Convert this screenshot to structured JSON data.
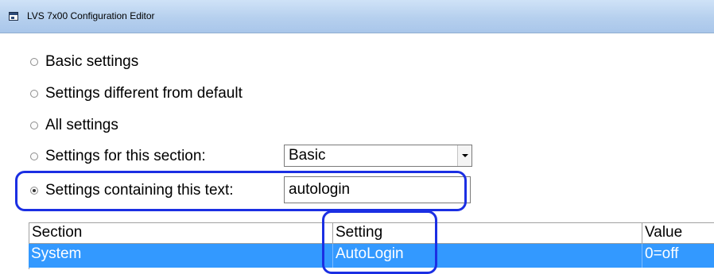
{
  "window": {
    "title": "LVS 7x00 Configuration Editor"
  },
  "options": [
    {
      "label": "Basic settings",
      "checked": false
    },
    {
      "label": "Settings different from default",
      "checked": false
    },
    {
      "label": "All settings",
      "checked": false
    },
    {
      "label": "Settings for this section:",
      "checked": false
    },
    {
      "label": "Settings containing this text:",
      "checked": true
    }
  ],
  "section_select": {
    "selected": "Basic"
  },
  "search_input": {
    "value": "autologin"
  },
  "table": {
    "columns": [
      "Section",
      "Setting",
      "Value"
    ],
    "rows": [
      {
        "section": "System",
        "setting": "AutoLogin",
        "value": "0=off",
        "selected": true
      }
    ]
  },
  "colors": {
    "highlight_annotation": "#1b2fe3",
    "row_selected": "#3399ff",
    "titlebar": "#b6d0ee"
  },
  "icons": {
    "title": "app-window-icon",
    "dropdown": "chevron-down-icon"
  }
}
